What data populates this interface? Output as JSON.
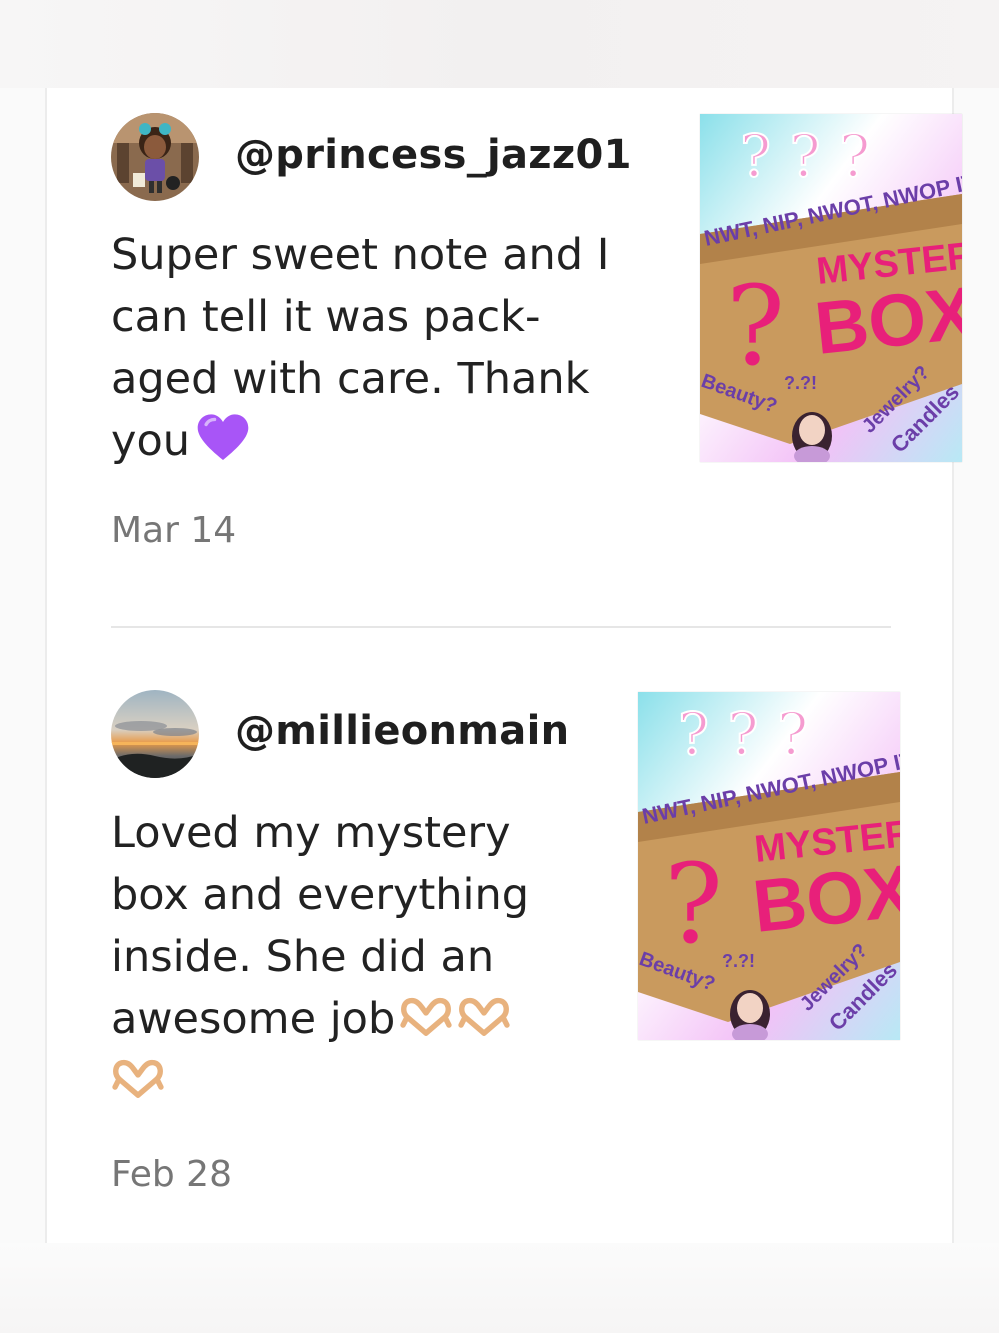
{
  "reviews": [
    {
      "username": "@princess_jazz01",
      "text": "Super sweet note and I\ncan tell it was pack-\naged with care. Thank\nyou",
      "emoji": "purple-heart",
      "date": "Mar 14",
      "image": {
        "line1": "NWT, NIP, NWOT, NWOP ITEMS",
        "title1": "MYSTERY",
        "title2": "BOX",
        "left": "Beauty?",
        "right1": "Jewelry?",
        "right2": "Candles",
        "sub": "?.?!"
      }
    },
    {
      "username": "@millieonmain",
      "text": "Loved my mystery\nbox and everything\ninside. She did an\nawesome job",
      "emoji": "heart-hands",
      "date": "Feb 28",
      "image": {
        "line1": "NWT, NIP, NWOT, NWOP ITEMS",
        "title1": "MYSTERY",
        "title2": "BOX",
        "left": "Beauty?",
        "right1": "Jewelry?",
        "right2": "Candles",
        "sub": "?.?!"
      }
    }
  ],
  "colors": {
    "text": "#222222",
    "date": "#767676",
    "divider": "#e6e6e6",
    "heart": "#a855f7"
  }
}
